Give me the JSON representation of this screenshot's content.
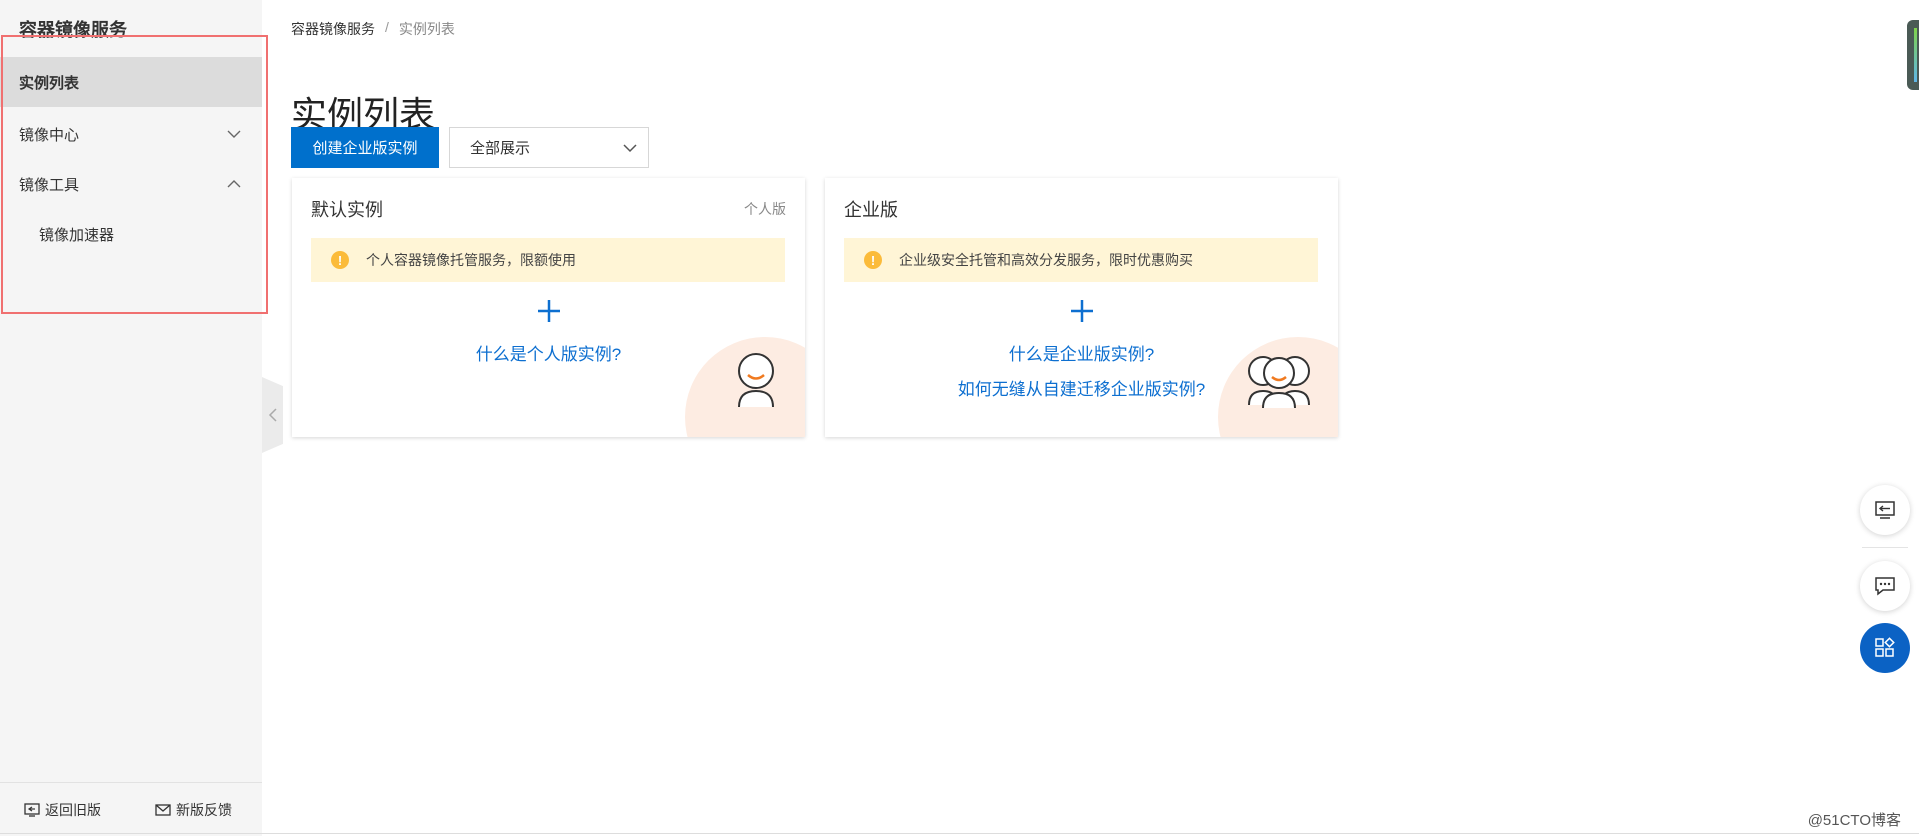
{
  "sidebar": {
    "title": "容器镜像服务",
    "items": [
      {
        "label": "实例列表",
        "active": true
      },
      {
        "label": "镜像中心",
        "expanded": false
      },
      {
        "label": "镜像工具",
        "expanded": true
      },
      {
        "label": "镜像加速器",
        "sub": true
      }
    ],
    "footer": {
      "back_label": "返回旧版",
      "feedback_label": "新版反馈"
    }
  },
  "breadcrumb": {
    "root": "容器镜像服务",
    "separator": "/",
    "current": "实例列表"
  },
  "page": {
    "title": "实例列表"
  },
  "toolbar": {
    "create_label": "创建企业版实例",
    "filter_selected": "全部展示"
  },
  "cards": {
    "personal": {
      "title": "默认实例",
      "tag": "个人版",
      "notice": "个人容器镜像托管服务，限额使用",
      "link_1": "什么是个人版实例?"
    },
    "enterprise": {
      "title": "企业版",
      "notice": "企业级安全托管和高效分发服务，限时优惠购买",
      "link_1": "什么是企业版实例?",
      "link_2": "如何无缝从自建迁移企业版实例?"
    }
  },
  "colors": {
    "primary": "#0070cc",
    "link": "#0d6fd0",
    "notice_bg": "#fff5d6",
    "warning": "#fbbb3a",
    "sidebar_bg": "#f5f5f5",
    "highlight_border": "#f07070"
  },
  "icons": {
    "warning": "warning-icon",
    "plus": "plus-icon",
    "chevron_down": "chevron-down-icon",
    "chevron_up": "chevron-up-icon",
    "back": "back-icon",
    "mail": "mail-icon",
    "collapse": "chevron-left-icon",
    "float_1": "exit-icon",
    "float_2": "chat-icon",
    "float_3": "apps-icon"
  },
  "watermark": "@51CTO博客"
}
